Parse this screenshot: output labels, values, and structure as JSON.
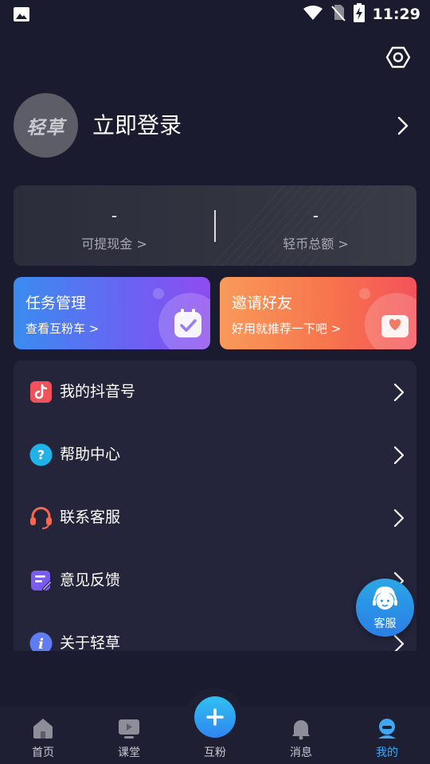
{
  "status_bar": {
    "time": "11:29"
  },
  "profile": {
    "avatar_text": "轻草",
    "login_label": "立即登录"
  },
  "balance": {
    "withdrawable": {
      "value": "-",
      "label": "可提现金 >"
    },
    "coins": {
      "value": "-",
      "label": "轻币总额 >"
    }
  },
  "promos": {
    "task": {
      "title": "任务管理",
      "subtitle": "查看互粉车 >"
    },
    "invite": {
      "title": "邀请好友",
      "subtitle": "好用就推荐一下吧 >"
    }
  },
  "menu": {
    "items": [
      {
        "label": "我的抖音号",
        "icon": "tiktok-icon",
        "color": "#f0515a"
      },
      {
        "label": "帮助中心",
        "icon": "help-icon",
        "color": "#1fb3e8"
      },
      {
        "label": "联系客服",
        "icon": "headset-icon",
        "color": "#f26a4f"
      },
      {
        "label": "意见反馈",
        "icon": "feedback-icon",
        "color": "#7c5cf0"
      },
      {
        "label": "关于轻草",
        "icon": "info-icon",
        "color": "#5f7cf2"
      }
    ]
  },
  "float_service": {
    "label": "客服"
  },
  "nav": {
    "items": [
      {
        "label": "首页",
        "icon": "home-icon"
      },
      {
        "label": "课堂",
        "icon": "classroom-icon"
      },
      {
        "label": "互粉",
        "icon": "plus-icon"
      },
      {
        "label": "消息",
        "icon": "bell-icon"
      },
      {
        "label": "我的",
        "icon": "profile-icon"
      }
    ],
    "active_index": 4
  },
  "colors": {
    "background": "#1a1b2e",
    "card": "#24253b",
    "accent": "#3fa8f4",
    "task_gradient": [
      "#3a8cf0",
      "#8f4cf0"
    ],
    "invite_gradient": [
      "#f89a5a",
      "#f4525a"
    ]
  }
}
